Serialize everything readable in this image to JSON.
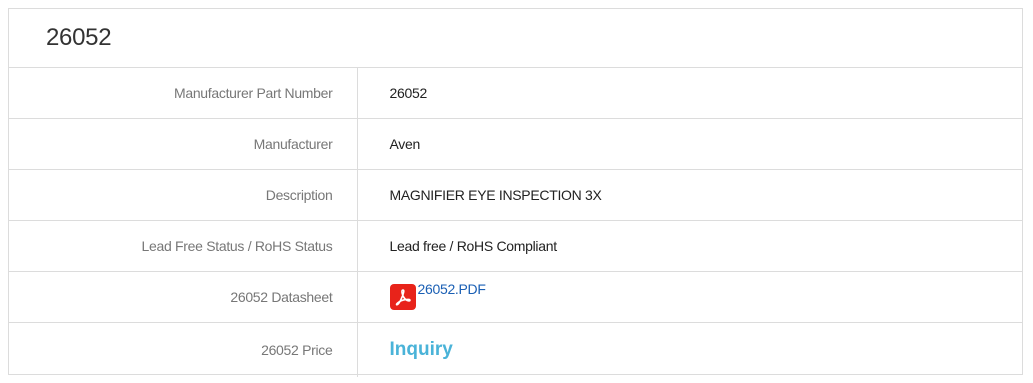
{
  "header": {
    "title": "26052"
  },
  "rows": [
    {
      "label": "Manufacturer Part Number",
      "value": "26052"
    },
    {
      "label": "Manufacturer",
      "value": "Aven"
    },
    {
      "label": "Description",
      "value": "MAGNIFIER EYE INSPECTION 3X"
    },
    {
      "label": "Lead Free Status / RoHS Status",
      "value": "Lead free / RoHS Compliant"
    },
    {
      "label": "26052 Datasheet",
      "value": "26052.PDF",
      "icon": "pdf-icon"
    },
    {
      "label": "26052 Price",
      "value": "Inquiry"
    }
  ],
  "colors": {
    "border": "#dcdcdc",
    "label": "#777777",
    "link": "#1a5fb4",
    "inquiry": "#4ab3d8",
    "pdf_icon": "#e8231a"
  }
}
